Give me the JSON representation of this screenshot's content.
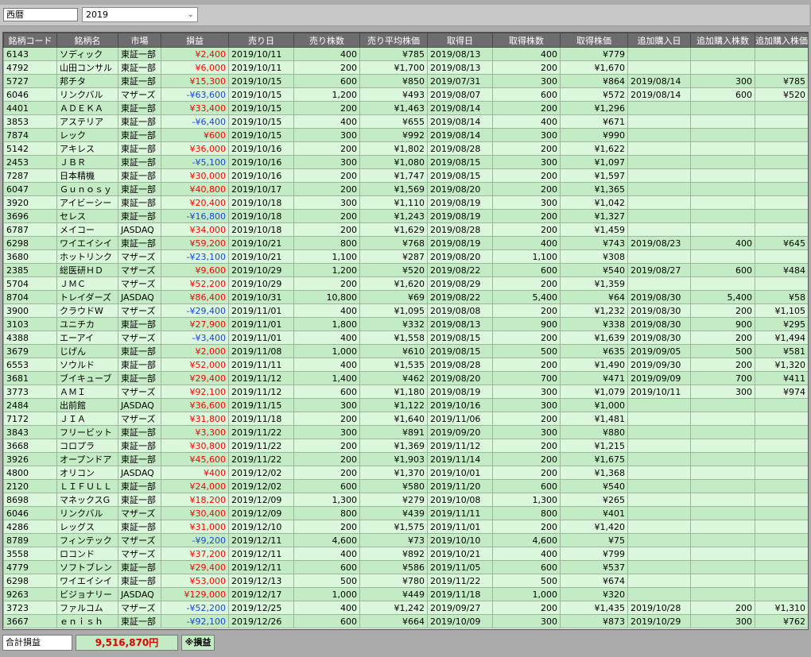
{
  "filter": {
    "era_label": "西暦",
    "year_value": "2019"
  },
  "columns": [
    "銘柄コード",
    "銘柄名",
    "市場",
    "損益",
    "売り日",
    "売り株数",
    "売り平均株価",
    "取得日",
    "取得株数",
    "取得株価",
    "追加購入日",
    "追加購入株数",
    "追加購入株価"
  ],
  "rows": [
    [
      "6143",
      "ソディック",
      "東証一部",
      "¥2,400",
      "2019/10/11",
      "400",
      "¥785",
      "2019/08/13",
      "400",
      "¥779",
      "",
      "",
      ""
    ],
    [
      "4792",
      "山田コンサル",
      "東証一部",
      "¥6,000",
      "2019/10/11",
      "200",
      "¥1,700",
      "2019/08/13",
      "200",
      "¥1,670",
      "",
      "",
      ""
    ],
    [
      "5727",
      "邦チタ",
      "東証一部",
      "¥15,300",
      "2019/10/15",
      "600",
      "¥850",
      "2019/07/31",
      "300",
      "¥864",
      "2019/08/14",
      "300",
      "¥785"
    ],
    [
      "6046",
      "リンクバル",
      "マザーズ",
      "-¥63,600",
      "2019/10/15",
      "1,200",
      "¥493",
      "2019/08/07",
      "600",
      "¥572",
      "2019/08/14",
      "600",
      "¥520"
    ],
    [
      "4401",
      "ＡＤＥＫＡ",
      "東証一部",
      "¥33,400",
      "2019/10/15",
      "200",
      "¥1,463",
      "2019/08/14",
      "200",
      "¥1,296",
      "",
      "",
      ""
    ],
    [
      "3853",
      "アステリア",
      "東証一部",
      "-¥6,400",
      "2019/10/15",
      "400",
      "¥655",
      "2019/08/14",
      "400",
      "¥671",
      "",
      "",
      ""
    ],
    [
      "7874",
      "レック",
      "東証一部",
      "¥600",
      "2019/10/15",
      "300",
      "¥992",
      "2019/08/14",
      "300",
      "¥990",
      "",
      "",
      ""
    ],
    [
      "5142",
      "アキレス",
      "東証一部",
      "¥36,000",
      "2019/10/16",
      "200",
      "¥1,802",
      "2019/08/28",
      "200",
      "¥1,622",
      "",
      "",
      ""
    ],
    [
      "2453",
      "ＪＢＲ",
      "東証一部",
      "-¥5,100",
      "2019/10/16",
      "300",
      "¥1,080",
      "2019/08/15",
      "300",
      "¥1,097",
      "",
      "",
      ""
    ],
    [
      "7287",
      "日本精機",
      "東証一部",
      "¥30,000",
      "2019/10/16",
      "200",
      "¥1,747",
      "2019/08/15",
      "200",
      "¥1,597",
      "",
      "",
      ""
    ],
    [
      "6047",
      "Ｇｕｎｏｓｙ",
      "東証一部",
      "¥40,800",
      "2019/10/17",
      "200",
      "¥1,569",
      "2019/08/20",
      "200",
      "¥1,365",
      "",
      "",
      ""
    ],
    [
      "3920",
      "アイビーシー",
      "東証一部",
      "¥20,400",
      "2019/10/18",
      "300",
      "¥1,110",
      "2019/08/19",
      "300",
      "¥1,042",
      "",
      "",
      ""
    ],
    [
      "3696",
      "セレス",
      "東証一部",
      "-¥16,800",
      "2019/10/18",
      "200",
      "¥1,243",
      "2019/08/19",
      "200",
      "¥1,327",
      "",
      "",
      ""
    ],
    [
      "6787",
      "メイコー",
      "JASDAQ",
      "¥34,000",
      "2019/10/18",
      "200",
      "¥1,629",
      "2019/08/28",
      "200",
      "¥1,459",
      "",
      "",
      ""
    ],
    [
      "6298",
      "ワイエイシイ",
      "東証一部",
      "¥59,200",
      "2019/10/21",
      "800",
      "¥768",
      "2019/08/19",
      "400",
      "¥743",
      "2019/08/23",
      "400",
      "¥645"
    ],
    [
      "3680",
      "ホットリンク",
      "マザーズ",
      "-¥23,100",
      "2019/10/21",
      "1,100",
      "¥287",
      "2019/08/20",
      "1,100",
      "¥308",
      "",
      "",
      ""
    ],
    [
      "2385",
      "総医研ＨＤ",
      "マザーズ",
      "¥9,600",
      "2019/10/29",
      "1,200",
      "¥520",
      "2019/08/22",
      "600",
      "¥540",
      "2019/08/27",
      "600",
      "¥484"
    ],
    [
      "5704",
      "ＪＭＣ",
      "マザーズ",
      "¥52,200",
      "2019/10/29",
      "200",
      "¥1,620",
      "2019/08/29",
      "200",
      "¥1,359",
      "",
      "",
      ""
    ],
    [
      "8704",
      "トレイダーズ",
      "JASDAQ",
      "¥86,400",
      "2019/10/31",
      "10,800",
      "¥69",
      "2019/08/22",
      "5,400",
      "¥64",
      "2019/08/30",
      "5,400",
      "¥58"
    ],
    [
      "3900",
      "クラウドW",
      "マザーズ",
      "-¥29,400",
      "2019/11/01",
      "400",
      "¥1,095",
      "2019/08/08",
      "200",
      "¥1,232",
      "2019/08/30",
      "200",
      "¥1,105"
    ],
    [
      "3103",
      "ユニチカ",
      "東証一部",
      "¥27,900",
      "2019/11/01",
      "1,800",
      "¥332",
      "2019/08/13",
      "900",
      "¥338",
      "2019/08/30",
      "900",
      "¥295"
    ],
    [
      "4388",
      "エーアイ",
      "マザーズ",
      "-¥3,400",
      "2019/11/01",
      "400",
      "¥1,558",
      "2019/08/15",
      "200",
      "¥1,639",
      "2019/08/30",
      "200",
      "¥1,494"
    ],
    [
      "3679",
      "じげん",
      "東証一部",
      "¥2,000",
      "2019/11/08",
      "1,000",
      "¥610",
      "2019/08/15",
      "500",
      "¥635",
      "2019/09/05",
      "500",
      "¥581"
    ],
    [
      "6553",
      "ソウルド",
      "東証一部",
      "¥52,000",
      "2019/11/11",
      "400",
      "¥1,535",
      "2019/08/28",
      "200",
      "¥1,490",
      "2019/09/30",
      "200",
      "¥1,320"
    ],
    [
      "3681",
      "ブイキューブ",
      "東証一部",
      "¥29,400",
      "2019/11/12",
      "1,400",
      "¥462",
      "2019/08/20",
      "700",
      "¥471",
      "2019/09/09",
      "700",
      "¥411"
    ],
    [
      "3773",
      "ＡＭＩ",
      "マザーズ",
      "¥92,100",
      "2019/11/12",
      "600",
      "¥1,180",
      "2019/08/19",
      "300",
      "¥1,079",
      "2019/10/11",
      "300",
      "¥974"
    ],
    [
      "2484",
      "出前館",
      "JASDAQ",
      "¥36,600",
      "2019/11/15",
      "300",
      "¥1,122",
      "2019/10/16",
      "300",
      "¥1,000",
      "",
      "",
      ""
    ],
    [
      "7172",
      "ＪＩＡ",
      "マザーズ",
      "¥31,800",
      "2019/11/18",
      "200",
      "¥1,640",
      "2019/11/06",
      "200",
      "¥1,481",
      "",
      "",
      ""
    ],
    [
      "3843",
      "フリービット",
      "東証一部",
      "¥3,300",
      "2019/11/22",
      "300",
      "¥891",
      "2019/09/20",
      "300",
      "¥880",
      "",
      "",
      ""
    ],
    [
      "3668",
      "コロプラ",
      "東証一部",
      "¥30,800",
      "2019/11/22",
      "200",
      "¥1,369",
      "2019/11/12",
      "200",
      "¥1,215",
      "",
      "",
      ""
    ],
    [
      "3926",
      "オープンドア",
      "東証一部",
      "¥45,600",
      "2019/11/22",
      "200",
      "¥1,903",
      "2019/11/14",
      "200",
      "¥1,675",
      "",
      "",
      ""
    ],
    [
      "4800",
      "オリコン",
      "JASDAQ",
      "¥400",
      "2019/12/02",
      "200",
      "¥1,370",
      "2019/10/01",
      "200",
      "¥1,368",
      "",
      "",
      ""
    ],
    [
      "2120",
      "ＬＩＦＵＬＬ",
      "東証一部",
      "¥24,000",
      "2019/12/02",
      "600",
      "¥580",
      "2019/11/20",
      "600",
      "¥540",
      "",
      "",
      ""
    ],
    [
      "8698",
      "マネックスG",
      "東証一部",
      "¥18,200",
      "2019/12/09",
      "1,300",
      "¥279",
      "2019/10/08",
      "1,300",
      "¥265",
      "",
      "",
      ""
    ],
    [
      "6046",
      "リンクバル",
      "マザーズ",
      "¥30,400",
      "2019/12/09",
      "800",
      "¥439",
      "2019/11/11",
      "800",
      "¥401",
      "",
      "",
      ""
    ],
    [
      "4286",
      "レッグス",
      "東証一部",
      "¥31,000",
      "2019/12/10",
      "200",
      "¥1,575",
      "2019/11/01",
      "200",
      "¥1,420",
      "",
      "",
      ""
    ],
    [
      "8789",
      "フィンテック",
      "マザーズ",
      "-¥9,200",
      "2019/12/11",
      "4,600",
      "¥73",
      "2019/10/10",
      "4,600",
      "¥75",
      "",
      "",
      ""
    ],
    [
      "3558",
      "ロコンド",
      "マザーズ",
      "¥37,200",
      "2019/12/11",
      "400",
      "¥892",
      "2019/10/21",
      "400",
      "¥799",
      "",
      "",
      ""
    ],
    [
      "4779",
      "ソフトブレン",
      "東証一部",
      "¥29,400",
      "2019/12/11",
      "600",
      "¥586",
      "2019/11/05",
      "600",
      "¥537",
      "",
      "",
      ""
    ],
    [
      "6298",
      "ワイエイシイ",
      "東証一部",
      "¥53,000",
      "2019/12/13",
      "500",
      "¥780",
      "2019/11/22",
      "500",
      "¥674",
      "",
      "",
      ""
    ],
    [
      "9263",
      "ビジョナリー",
      "JASDAQ",
      "¥129,000",
      "2019/12/17",
      "1,000",
      "¥449",
      "2019/11/18",
      "1,000",
      "¥320",
      "",
      "",
      ""
    ],
    [
      "3723",
      "ファルコム",
      "マザーズ",
      "-¥52,200",
      "2019/12/25",
      "400",
      "¥1,242",
      "2019/09/27",
      "200",
      "¥1,435",
      "2019/10/28",
      "200",
      "¥1,310"
    ],
    [
      "3667",
      "ｅｎｉｓｈ",
      "東証一部",
      "-¥92,100",
      "2019/12/26",
      "600",
      "¥664",
      "2019/10/09",
      "300",
      "¥873",
      "2019/10/29",
      "300",
      "¥762"
    ]
  ],
  "footer": {
    "total_label": "合計損益",
    "total_value": "9,516,870円",
    "note": "※損益"
  },
  "colors": {
    "profit": "#ff0000",
    "loss": "#1a45e0",
    "row_a": "#c4ecc4",
    "row_b": "#dcf8dc",
    "header": "#6d6d6d"
  },
  "icons": {
    "dropdown": "chevron-down-icon"
  }
}
